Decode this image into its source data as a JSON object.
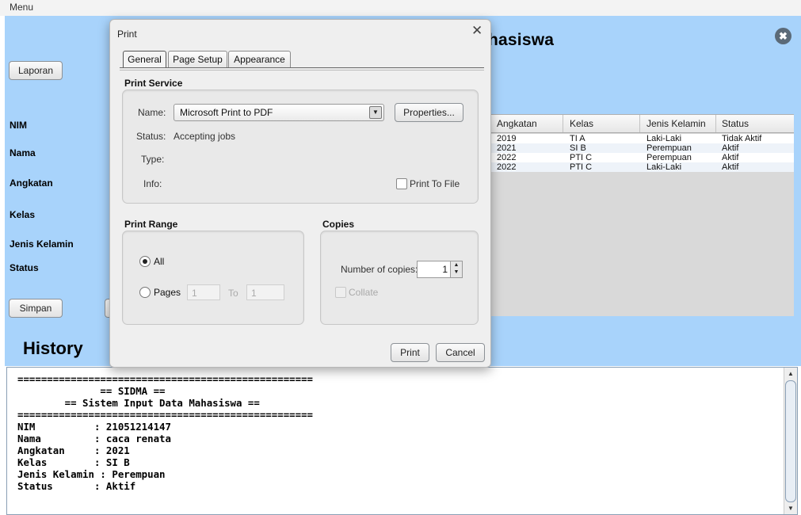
{
  "menubar": {
    "menu_label": "Menu"
  },
  "app": {
    "title_fragment": "hasiswa",
    "close_glyph": "✖"
  },
  "left_panel": {
    "laporan_button": "Laporan",
    "simpan_button": "Simpan",
    "labels": [
      "NIM",
      "Nama",
      "Angkatan",
      "Kelas",
      "Jenis Kelamin",
      "Status"
    ]
  },
  "table": {
    "columns": [
      "Angkatan",
      "Kelas",
      "Jenis Kelamin",
      "Status"
    ],
    "rows": [
      [
        "2019",
        "TI A",
        "Laki-Laki",
        "Tidak Aktif"
      ],
      [
        "2021",
        "SI B",
        "Perempuan",
        "Aktif"
      ],
      [
        "2022",
        "PTI C",
        "Perempuan",
        "Aktif"
      ],
      [
        "2022",
        "PTI C",
        "Laki-Laki",
        "Aktif"
      ]
    ]
  },
  "history": {
    "title": "History",
    "text": "==================================================\n              == SIDMA ==\n        == Sistem Input Data Mahasiswa ==\n==================================================\nNIM          : 21051214147\nNama         : caca renata\nAngkatan     : 2021\nKelas        : SI B\nJenis Kelamin : Perempuan\nStatus       : Aktif"
  },
  "print_dialog": {
    "title": "Print",
    "close_glyph": "✕",
    "tabs": [
      "General",
      "Page Setup",
      "Appearance"
    ],
    "print_service": {
      "section_title": "Print Service",
      "name_label": "Name:",
      "name_value": "Microsoft Print to PDF",
      "properties_button": "Properties...",
      "status_label": "Status:",
      "status_value": "Accepting jobs",
      "type_label": "Type:",
      "info_label": "Info:",
      "print_to_file_label": "Print To File"
    },
    "print_range": {
      "section_title": "Print Range",
      "all_label": "All",
      "pages_label": "Pages",
      "pages_from": "1",
      "to_label": "To",
      "pages_to": "1"
    },
    "copies": {
      "section_title": "Copies",
      "number_label": "Number of copies:",
      "number_value": "1",
      "collate_label": "Collate"
    },
    "print_button": "Print",
    "cancel_button": "Cancel"
  }
}
